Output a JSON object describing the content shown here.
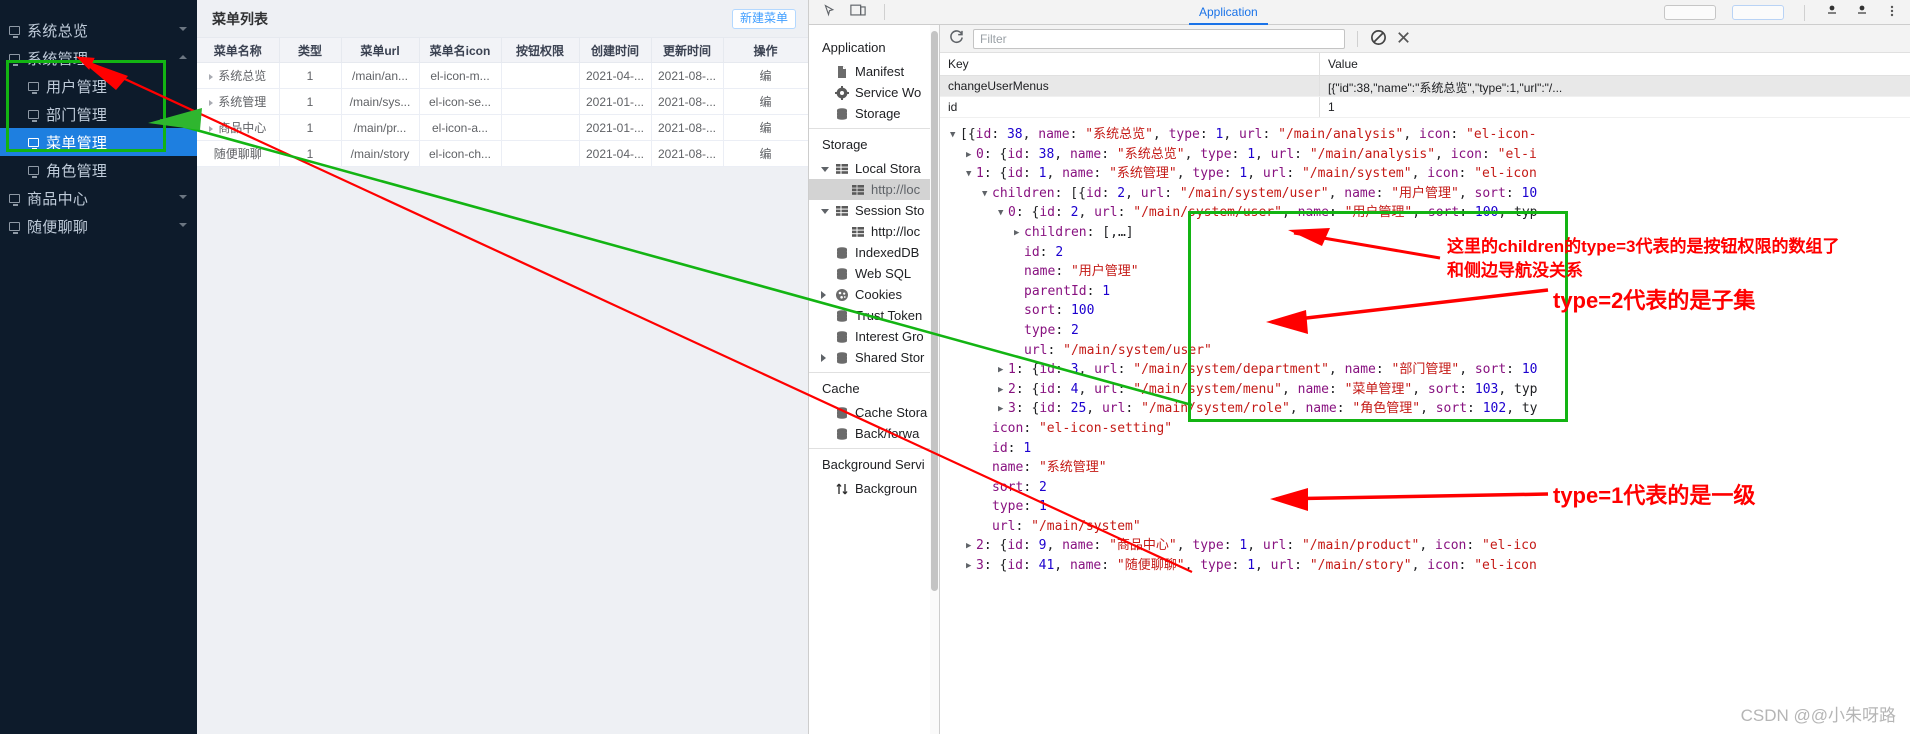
{
  "app_sidebar": {
    "items": [
      {
        "label": "系统总览",
        "level": 1,
        "active": false,
        "caret": "down"
      },
      {
        "label": "系统管理",
        "level": 1,
        "active": false,
        "caret": "up"
      },
      {
        "label": "用户管理",
        "level": 2,
        "active": false,
        "caret": ""
      },
      {
        "label": "部门管理",
        "level": 2,
        "active": false,
        "caret": ""
      },
      {
        "label": "菜单管理",
        "level": 2,
        "active": true,
        "caret": ""
      },
      {
        "label": "角色管理",
        "level": 2,
        "active": false,
        "caret": ""
      },
      {
        "label": "商品中心",
        "level": 1,
        "active": false,
        "caret": "down"
      },
      {
        "label": "随便聊聊",
        "level": 1,
        "active": false,
        "caret": "down"
      }
    ]
  },
  "page": {
    "title": "菜单列表",
    "new_button": "新建菜单",
    "table": {
      "columns": [
        "菜单名称",
        "类型",
        "菜单url",
        "菜单名icon",
        "按钮权限",
        "创建时间",
        "更新时间",
        "操作"
      ],
      "rows": [
        {
          "name": "系统总览",
          "type": "1",
          "url": "/main/an...",
          "icon": "el-icon-m...",
          "perm": "",
          "created": "2021-04-...",
          "updated": "2021-08-...",
          "op": "编",
          "expandable": true
        },
        {
          "name": "系统管理",
          "type": "1",
          "url": "/main/sys...",
          "icon": "el-icon-se...",
          "perm": "",
          "created": "2021-01-...",
          "updated": "2021-08-...",
          "op": "编",
          "expandable": true
        },
        {
          "name": "商品中心",
          "type": "1",
          "url": "/main/pr...",
          "icon": "el-icon-a...",
          "perm": "",
          "created": "2021-01-...",
          "updated": "2021-08-...",
          "op": "编",
          "expandable": true
        },
        {
          "name": "随便聊聊",
          "type": "1",
          "url": "/main/story",
          "icon": "el-icon-ch...",
          "perm": "",
          "created": "2021-04-...",
          "updated": "2021-08-...",
          "op": "编",
          "expandable": false
        }
      ]
    }
  },
  "devtools": {
    "active_tab": "Application",
    "nav": {
      "section_application": "Application",
      "application_items": [
        {
          "label": "Manifest",
          "icon": "document-icon",
          "indent": 1,
          "tri": "",
          "selected": false
        },
        {
          "label": "Service Wo",
          "icon": "gear-icon",
          "indent": 1,
          "tri": "",
          "selected": false
        },
        {
          "label": "Storage",
          "icon": "database-icon",
          "indent": 1,
          "tri": "",
          "selected": false
        }
      ],
      "section_storage": "Storage",
      "storage_items": [
        {
          "label": "Local Stora",
          "icon": "table-icon",
          "indent": 1,
          "tri": "open",
          "selected": false
        },
        {
          "label": "http://loc",
          "icon": "table-icon",
          "indent": 2,
          "tri": "",
          "selected": true
        },
        {
          "label": "Session Sto",
          "icon": "table-icon",
          "indent": 1,
          "tri": "open",
          "selected": false
        },
        {
          "label": "http://loc",
          "icon": "table-icon",
          "indent": 2,
          "tri": "",
          "selected": false
        },
        {
          "label": "IndexedDB",
          "icon": "database-icon",
          "indent": 1,
          "tri": "",
          "selected": false
        },
        {
          "label": "Web SQL",
          "icon": "database-icon",
          "indent": 1,
          "tri": "",
          "selected": false
        },
        {
          "label": "Cookies",
          "icon": "cookie-icon",
          "indent": 1,
          "tri": "closed",
          "selected": false
        },
        {
          "label": "Trust Token",
          "icon": "database-icon",
          "indent": 1,
          "tri": "",
          "selected": false
        },
        {
          "label": "Interest Gro",
          "icon": "database-icon",
          "indent": 1,
          "tri": "",
          "selected": false
        },
        {
          "label": "Shared Stor",
          "icon": "database-icon",
          "indent": 1,
          "tri": "closed",
          "selected": false
        }
      ],
      "section_cache": "Cache",
      "cache_items": [
        {
          "label": "Cache Stora",
          "icon": "database-icon",
          "indent": 1,
          "tri": "",
          "selected": false
        },
        {
          "label": "Back/forwa",
          "icon": "database-icon",
          "indent": 1,
          "tri": "",
          "selected": false
        }
      ],
      "section_background": "Background Servi",
      "background_items": [
        {
          "label": "Backgroun",
          "icon": "arrows-icon",
          "indent": 1,
          "tri": "",
          "selected": false
        }
      ]
    },
    "toolbar": {
      "refresh_icon": "refresh-icon",
      "filter_placeholder": "Filter",
      "clear_icon": "no-entry-icon",
      "close_icon": "close-icon"
    },
    "kv_table": {
      "col_key": "Key",
      "col_value": "Value",
      "rows": [
        {
          "key": "changeUserMenus",
          "value": "[{\"id\":38,\"name\":\"系统总览\",\"type\":1,\"url\":\"/...",
          "selected": true
        },
        {
          "key": "id",
          "value": "1",
          "selected": false
        }
      ]
    },
    "json_lines": [
      {
        "indent": 0,
        "tri": "open",
        "html": "[{id: 38, name: \"系统总览\", type: 1, url: \"/main/analysis\", icon: \"el-icon-"
      },
      {
        "indent": 1,
        "tri": "closed",
        "html": "0: {id: 38, name: \"系统总览\", type: 1, url: \"/main/analysis\", icon: \"el-i"
      },
      {
        "indent": 1,
        "tri": "open",
        "html": "1: {id: 1, name: \"系统管理\", type: 1, url: \"/main/system\", icon: \"el-icon"
      },
      {
        "indent": 2,
        "tri": "open",
        "html": "children: [{id: 2, url: \"/main/system/user\", name: \"用户管理\", sort: 10"
      },
      {
        "indent": 3,
        "tri": "open",
        "html": "0: {id: 2, url: \"/main/system/user\", name: \"用户管理\", sort: 100, typ"
      },
      {
        "indent": 4,
        "tri": "closed",
        "html": "children: [,…]"
      },
      {
        "indent": 4,
        "tri": "",
        "html": "id: 2"
      },
      {
        "indent": 4,
        "tri": "",
        "html": "name: \"用户管理\""
      },
      {
        "indent": 4,
        "tri": "",
        "html": "parentId: 1"
      },
      {
        "indent": 4,
        "tri": "",
        "html": "sort: 100"
      },
      {
        "indent": 4,
        "tri": "",
        "html": "type: 2"
      },
      {
        "indent": 4,
        "tri": "",
        "html": "url: \"/main/system/user\""
      },
      {
        "indent": 3,
        "tri": "closed",
        "html": "1: {id: 3, url: \"/main/system/department\", name: \"部门管理\", sort: 10"
      },
      {
        "indent": 3,
        "tri": "closed",
        "html": "2: {id: 4, url: \"/main/system/menu\", name: \"菜单管理\", sort: 103, typ"
      },
      {
        "indent": 3,
        "tri": "closed",
        "html": "3: {id: 25, url: \"/main/system/role\", name: \"角色管理\", sort: 102, ty"
      },
      {
        "indent": 2,
        "tri": "",
        "html": "icon: \"el-icon-setting\""
      },
      {
        "indent": 2,
        "tri": "",
        "html": "id: 1"
      },
      {
        "indent": 2,
        "tri": "",
        "html": "name: \"系统管理\""
      },
      {
        "indent": 2,
        "tri": "",
        "html": "sort: 2"
      },
      {
        "indent": 2,
        "tri": "",
        "html": "type: 1"
      },
      {
        "indent": 2,
        "tri": "",
        "html": "url: \"/main/system\""
      },
      {
        "indent": 1,
        "tri": "closed",
        "html": "2: {id: 9, name: \"商品中心\", type: 1, url: \"/main/product\", icon: \"el-ico"
      },
      {
        "indent": 1,
        "tri": "closed",
        "html": "3: {id: 41, name: \"随便聊聊\", type: 1, url: \"/main/story\", icon: \"el-icon"
      }
    ]
  },
  "annotations": {
    "note_children_type3_line1": "这里的children的type=3代表的是按钮权限的数组了",
    "note_children_type3_line2": "和侧边导航没关系",
    "note_type2": "type=2代表的是子集",
    "note_type1": "type=1代表的是一级"
  },
  "watermark": "CSDN @@小朱呀路",
  "colors": {
    "sidebar_bg": "#0d1b2b",
    "sidebar_active": "#1e7fe0",
    "annotation_red": "#ff0000",
    "annotation_green": "#13b413",
    "link_blue": "#409eff"
  }
}
